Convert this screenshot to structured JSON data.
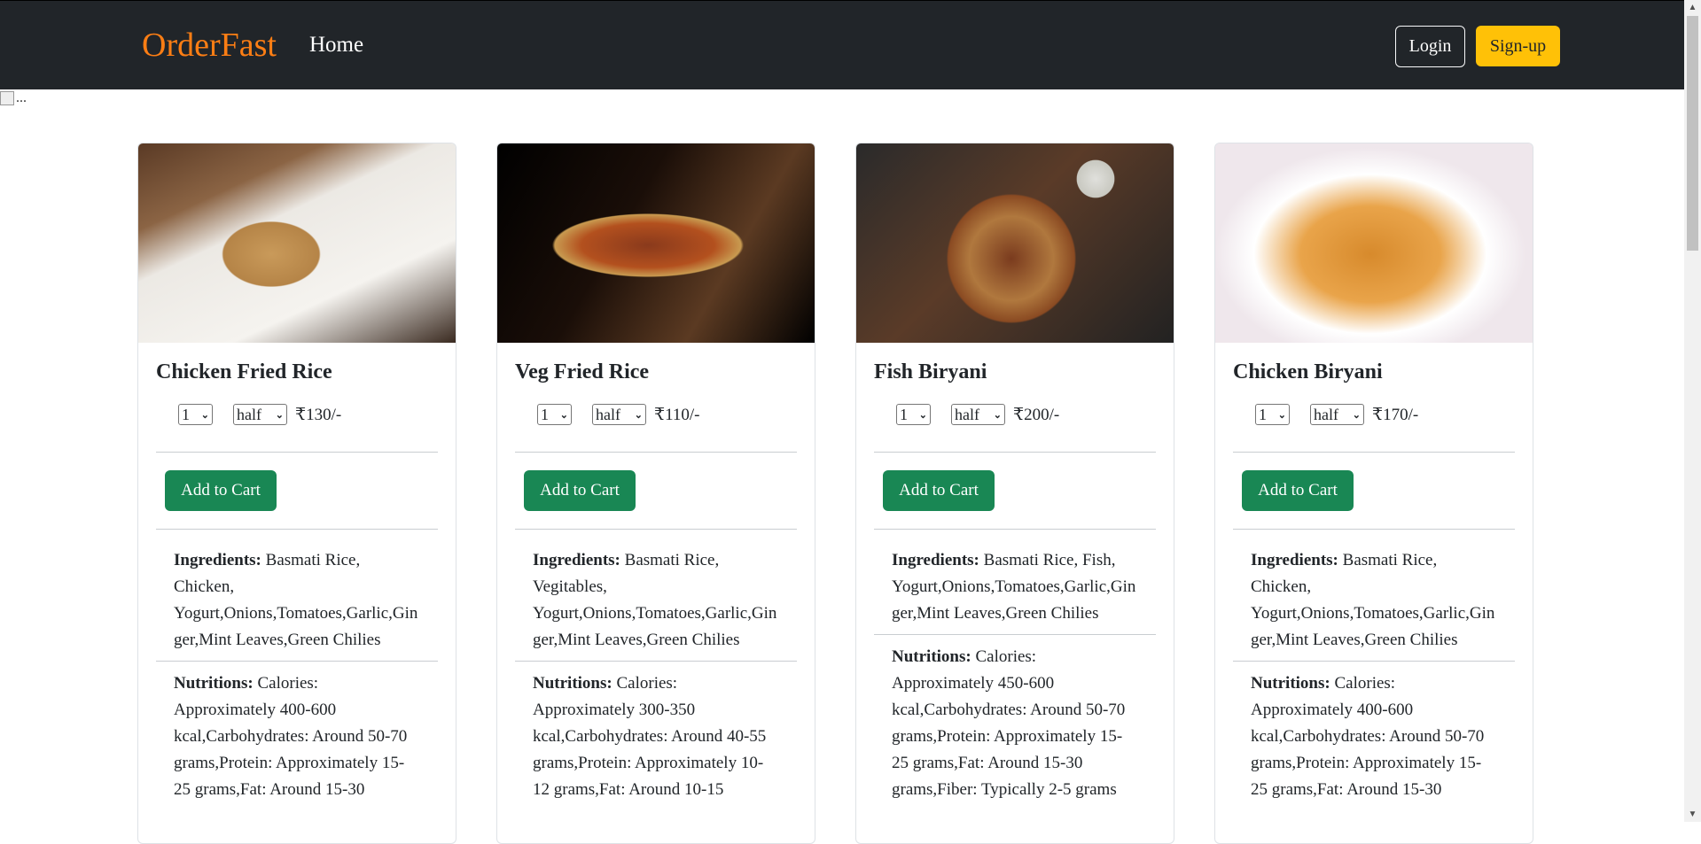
{
  "navbar": {
    "brand": "OrderFast",
    "home": "Home",
    "login": "Login",
    "signup": "Sign-up",
    "brand_color": "#fd7e14",
    "bg_color": "#212529"
  },
  "broken_image_alt": "...",
  "cards": [
    {
      "title": "Chicken Fried Rice",
      "qty": "1",
      "size": "half",
      "price": "₹130/-",
      "add_to_cart": "Add to Cart",
      "ingredients_label": "Ingredients:",
      "ingredients": " Basmati Rice, Chicken, Yogurt,Onions,Tomatoes,Garlic,Ginger,Mint Leaves,Green Chilies",
      "nutritions_label": "Nutritions:",
      "nutritions": " Calories: Approximately 400-600 kcal,Carbohydrates: Around 50-70 grams,Protein: Approximately 15-25 grams,Fat: Around 15-30"
    },
    {
      "title": "Veg Fried Rice",
      "qty": "1",
      "size": "half",
      "price": "₹110/-",
      "add_to_cart": "Add to Cart",
      "ingredients_label": "Ingredients:",
      "ingredients": " Basmati Rice, Vegitables, Yogurt,Onions,Tomatoes,Garlic,Ginger,Mint Leaves,Green Chilies",
      "nutritions_label": "Nutritions:",
      "nutritions": " Calories: Approximately 300-350 kcal,Carbohydrates: Around 40-55 grams,Protein: Approximately 10-12 grams,Fat: Around 10-15"
    },
    {
      "title": "Fish Biryani",
      "qty": "1",
      "size": "half",
      "price": "₹200/-",
      "add_to_cart": "Add to Cart",
      "ingredients_label": "Ingredients:",
      "ingredients": " Basmati Rice, Fish, Yogurt,Onions,Tomatoes,Garlic,Ginger,Mint Leaves,Green Chilies",
      "nutritions_label": "Nutritions:",
      "nutritions": " Calories: Approximately 450-600 kcal,Carbohydrates: Around 50-70 grams,Protein: Approximately 15-25 grams,Fat: Around 15-30 grams,Fiber: Typically 2-5 grams"
    },
    {
      "title": "Chicken Biryani",
      "qty": "1",
      "size": "half",
      "price": "₹170/-",
      "add_to_cart": "Add to Cart",
      "ingredients_label": "Ingredients:",
      "ingredients": " Basmati Rice, Chicken, Yogurt,Onions,Tomatoes,Garlic,Ginger,Mint Leaves,Green Chilies",
      "nutritions_label": "Nutritions:",
      "nutritions": " Calories: Approximately 400-600 kcal,Carbohydrates: Around 50-70 grams,Protein: Approximately 15-25 grams,Fat: Around 15-30"
    }
  ],
  "colors": {
    "add_to_cart": "#198754",
    "signup": "#ffc107"
  }
}
